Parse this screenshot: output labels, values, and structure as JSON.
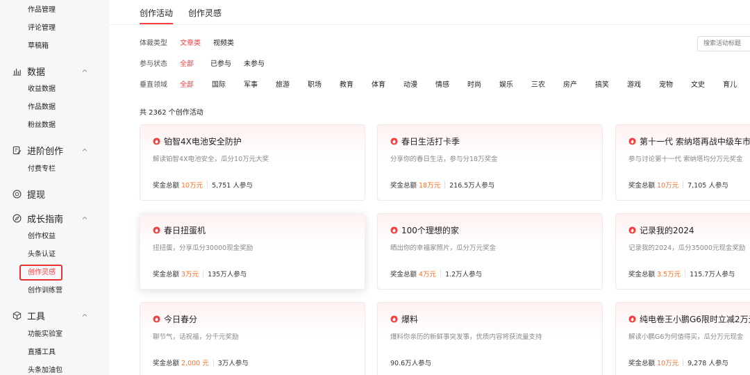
{
  "sidebar": {
    "top_items": [
      "作品管理",
      "评论管理",
      "草稿箱"
    ],
    "groups": [
      {
        "label": "数据",
        "icon": "bar-chart-icon",
        "items": [
          "收益数据",
          "作品数据",
          "粉丝数据"
        ]
      },
      {
        "label": "进阶创作",
        "icon": "edit-icon",
        "items": [
          "付费专栏"
        ]
      },
      {
        "label": "提现",
        "icon": "coin-icon",
        "items": []
      },
      {
        "label": "成长指南",
        "icon": "compass-icon",
        "items": [
          "创作权益",
          "头条认证",
          "创作灵感",
          "创作训练营"
        ]
      },
      {
        "label": "工具",
        "icon": "cube-icon",
        "items": [
          "功能实验室",
          "直播工具",
          "头条加油包"
        ]
      }
    ],
    "active_item": "创作灵感"
  },
  "tabs": [
    {
      "label": "创作活动",
      "active": true
    },
    {
      "label": "创作灵感",
      "active": false
    }
  ],
  "filters": {
    "genre": {
      "label": "体裁类型",
      "options": [
        "文章类",
        "视频类"
      ],
      "selected": "文章类"
    },
    "status": {
      "label": "参与状态",
      "options": [
        "全部",
        "已参与",
        "未参与"
      ],
      "selected": "全部"
    },
    "vertical": {
      "label": "垂直领域",
      "options": [
        "全部",
        "国际",
        "军事",
        "旅游",
        "职场",
        "教育",
        "体育",
        "动漫",
        "情感",
        "时尚",
        "娱乐",
        "三农",
        "房产",
        "搞笑",
        "游戏",
        "宠物",
        "文史",
        "育儿"
      ],
      "selected": "全部"
    }
  },
  "search": {
    "placeholder": "搜索活动标题"
  },
  "count_text": "共 2362 个创作活动",
  "colors": {
    "accent": "#f04142",
    "amount": "#f0752d",
    "sidebar_bg": "#f6f7f9"
  },
  "cards": [
    {
      "title": "铂智4X电池安全防护",
      "desc": "解读铂智4X电池安全，瓜分10万元大奖",
      "prize_label": "奖金总额",
      "prize": "10万元",
      "participants": "5,751 人参与"
    },
    {
      "title": "春日生活打卡季",
      "desc": "分享你的春日生活，参与分18万奖金",
      "prize_label": "奖金总额",
      "prize": "18万元",
      "participants": "216.5万人参与"
    },
    {
      "title": "第十一代 索纳塔再战中级车市场",
      "desc": "参与讨论第十一代 索纳塔均分万元奖金",
      "prize_label": "奖金总额",
      "prize": "10万元",
      "participants": "7,105 人参与"
    },
    {
      "title": "春日扭蛋机",
      "desc": "扭扭蛋，分享瓜分30000现金奖励",
      "prize_label": "奖金总额",
      "prize": "3万元",
      "participants": "135万人参与"
    },
    {
      "title": "100个理想的家",
      "desc": "晒出你的幸福家照片，瓜分万元奖金",
      "prize_label": "奖金总额",
      "prize": "4万元",
      "participants": "1.2万人参与"
    },
    {
      "title": "记录我的2024",
      "desc": "记录我的2024，瓜分35000元现金奖励",
      "prize_label": "奖金总额",
      "prize": "3.5万元",
      "participants": "115.7万人参与"
    },
    {
      "title": "今日春分",
      "desc": "聊节气，话祝福，分千元奖励",
      "prize_label": "奖金总额",
      "prize": "2,000 元",
      "participants": "3万人参与"
    },
    {
      "title": "爆料",
      "desc": "爆料你亲历的新鲜事突发事，优质内容将获流量支持",
      "prize_label": "",
      "prize": "",
      "participants": "90.6万人参与"
    },
    {
      "title": "纯电卷王小鹏G6限时立减2万元",
      "desc": "解读小鹏G6为何值得买，瓜分万元现金",
      "prize_label": "奖金总额",
      "prize": "10万元",
      "participants": "9,278 人参与"
    }
  ]
}
